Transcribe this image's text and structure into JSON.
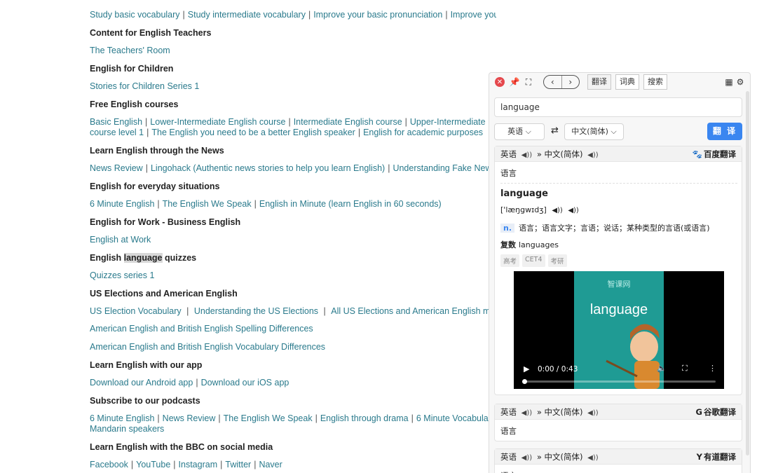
{
  "page": {
    "sections": [
      {
        "heading": "",
        "links": [
          "Study basic vocabulary",
          "Study intermediate vocabulary",
          "Improve your basic pronunciation",
          "Improve your intermediate pronunciation"
        ],
        "links2": []
      },
      {
        "heading": "Content for English Teachers",
        "links": [
          "The Teachers' Room"
        ],
        "links2": []
      },
      {
        "heading": "English for Children",
        "links": [
          "Stories for Children Series 1"
        ],
        "links2": []
      },
      {
        "heading": "Free English courses",
        "links": [
          "Basic English",
          "Lower-Intermediate English course",
          "Intermediate English course",
          "Upper-Intermediate Engli"
        ],
        "links2": [
          "course level 1",
          "The English you need to be a better English speaker",
          "English for academic purposes"
        ]
      },
      {
        "heading": "Learn English through the News",
        "links": [
          "News Review",
          "Lingohack (Authentic news stories to help you learn English)",
          "Understanding Fake News"
        ],
        "links2": []
      },
      {
        "heading": "English for everyday situations",
        "links": [
          "6 Minute English",
          "The English We Speak",
          "English in Minute (learn English in 60 seconds)"
        ],
        "links2": []
      },
      {
        "heading": "English for Work - Business English",
        "links": [
          "English at Work"
        ],
        "links2": []
      },
      {
        "heading": "",
        "links": [
          "Quizzes series 1"
        ],
        "links2": []
      },
      {
        "heading": "US Elections and American English",
        "links": [
          "US Election Vocabulary",
          "Understanding the US Elections",
          "All US Elections and American English materi"
        ],
        "links2": []
      },
      {
        "heading": "",
        "links": [
          "American English and British English Spelling Differences"
        ],
        "links2": []
      },
      {
        "heading": "",
        "links": [
          "American English and British English Vocabulary Differences"
        ],
        "links2": []
      },
      {
        "heading": "Learn English with our app",
        "links": [
          "Download our Android app",
          "Download our iOS app"
        ],
        "links2": []
      },
      {
        "heading": "Subscribe to our podcasts",
        "links": [
          "6 Minute English",
          "News Review",
          "The English We Speak",
          "English through drama",
          "6 Minute Vocabulary",
          "6"
        ],
        "links2": [
          "Mandarin speakers"
        ]
      },
      {
        "heading": "Learn English with the BBC on social media",
        "links": [
          "Facebook",
          "YouTube",
          "Instagram",
          "Twitter",
          "Naver"
        ],
        "links2": []
      }
    ],
    "quiz_heading": {
      "before": "English ",
      "highlighted": "language",
      "after": " quizzes"
    }
  },
  "popup": {
    "tabs": [
      "翻译",
      "词典",
      "搜索"
    ],
    "query": "language",
    "source_lang": "英语",
    "target_lang": "中文(简体)",
    "translate_label": "翻 译",
    "baidu": {
      "src": "英语",
      "arrow": "»",
      "dst": "中文(简体)",
      "provider": "百度翻译",
      "translation": "语言",
      "word": "language",
      "phonetic": "['læŋgwɪdʒ]",
      "pos": "n.",
      "definition": "语言；语言文字；言语；说话；某种类型的言语(或语言)",
      "plural_label": "复数",
      "plural_value": "languages",
      "tags": [
        "高考",
        "CET4",
        "考研"
      ],
      "video": {
        "logo": "智课网",
        "word": "language",
        "time": "0:00 / 0:43"
      }
    },
    "google": {
      "src": "英语",
      "arrow": "»",
      "dst": "中文(简体)",
      "provider": "谷歌翻译",
      "translation": "语言"
    },
    "youdao": {
      "src": "英语",
      "arrow": "»",
      "dst": "中文(简体)",
      "provider": "有道翻译",
      "translation": "语言"
    }
  },
  "icons": {
    "close": "close-icon",
    "pin": "pin-icon",
    "expand": "expand-icon",
    "back": "chevron-left-icon",
    "forward": "chevron-right-icon",
    "grid": "grid-icon",
    "settings": "gear-icon",
    "swap": "swap-icon",
    "speaker": "speaker-icon",
    "baidu": "paw-icon",
    "google": "google-g-icon",
    "youdao": "youdao-y-icon"
  },
  "colors": {
    "link": "#2a7a8c",
    "accent": "#3a86f0",
    "close": "#e5484d",
    "video_bg": "#1f9b94"
  }
}
